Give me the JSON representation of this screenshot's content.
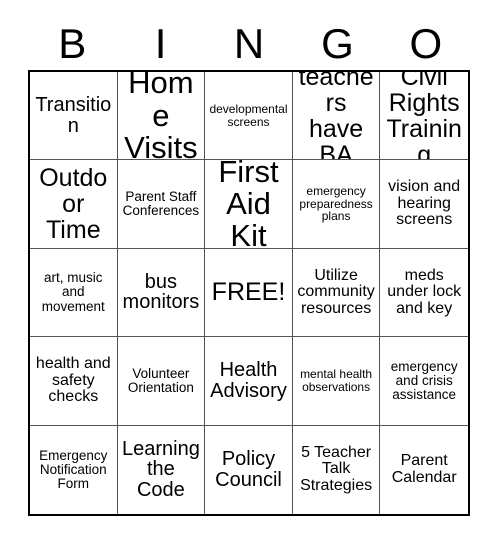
{
  "card": {
    "title": "BINGO",
    "header_letters": [
      "B",
      "I",
      "N",
      "G",
      "O"
    ],
    "grid_size": 5,
    "free_space": "FREE!",
    "colors": {
      "background": "#ffffff",
      "text": "#000000",
      "outer_border": "#000000",
      "inner_border": "#555555"
    },
    "cells": [
      {
        "text": "Transition",
        "size": "md"
      },
      {
        "text": "Home Visits",
        "size": "xl"
      },
      {
        "text": "developmental screens",
        "size": "xxs"
      },
      {
        "text": "teachers have BA",
        "size": "lg"
      },
      {
        "text": "Civil Rights Training",
        "size": "lg"
      },
      {
        "text": "Outdoor Time",
        "size": "lg"
      },
      {
        "text": "Parent Staff Conferences",
        "size": "xs"
      },
      {
        "text": "First Aid Kit",
        "size": "xl"
      },
      {
        "text": "emergency preparedness plans",
        "size": "xxs"
      },
      {
        "text": "vision and hearing screens",
        "size": "sm"
      },
      {
        "text": "art, music and movement",
        "size": "xs"
      },
      {
        "text": "bus monitors",
        "size": "md"
      },
      {
        "text": "FREE!",
        "size": "lg"
      },
      {
        "text": "Utilize community resources",
        "size": "sm"
      },
      {
        "text": "meds under lock and key",
        "size": "sm"
      },
      {
        "text": "health and safety checks",
        "size": "sm"
      },
      {
        "text": "Volunteer Orientation",
        "size": "xs"
      },
      {
        "text": "Health Advisory",
        "size": "md"
      },
      {
        "text": "mental health observations",
        "size": "xxs"
      },
      {
        "text": "emergency and crisis assistance",
        "size": "xs"
      },
      {
        "text": "Emergency Notification Form",
        "size": "xs"
      },
      {
        "text": "Learning the Code",
        "size": "md"
      },
      {
        "text": "Policy Council",
        "size": "md"
      },
      {
        "text": "5 Teacher Talk Strategies",
        "size": "sm"
      },
      {
        "text": "Parent Calendar",
        "size": "sm"
      }
    ]
  }
}
